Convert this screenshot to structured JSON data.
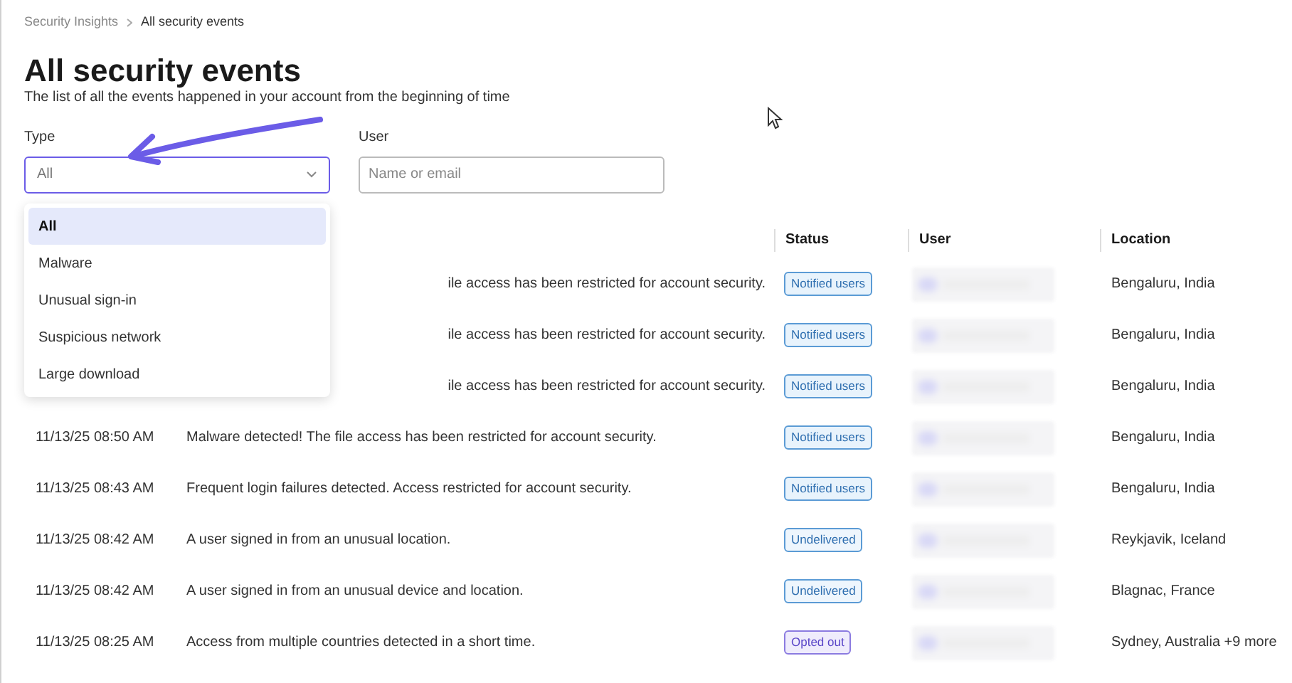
{
  "breadcrumb": [
    "Security Insights",
    "All security events"
  ],
  "title": "All security events",
  "subtitle": "The list of all the events happened in your account from the beginning of time",
  "filters": {
    "type": {
      "label": "Type",
      "value": "All",
      "expanded": true,
      "options": [
        {
          "label": "All",
          "selected": true
        },
        {
          "label": "Malware",
          "selected": false
        },
        {
          "label": "Unusual sign-in",
          "selected": false
        },
        {
          "label": "Suspicious network",
          "selected": false
        },
        {
          "label": "Large download",
          "selected": false
        }
      ]
    },
    "user": {
      "label": "User",
      "placeholder": "Name or email"
    }
  },
  "table": {
    "columns": [
      "Status",
      "User",
      "Location"
    ],
    "rows": [
      {
        "message": "ile access has been restricted for account security.",
        "status": {
          "text": "Notified users",
          "kind": "notified"
        },
        "location": "Bengaluru, India"
      },
      {
        "message": "ile access has been restricted for account security.",
        "status": {
          "text": "Notified users",
          "kind": "notified"
        },
        "location": "Bengaluru, India"
      },
      {
        "message": "ile access has been restricted for account security.",
        "status": {
          "text": "Notified users",
          "kind": "notified"
        },
        "location": "Bengaluru, India"
      },
      {
        "time": "11/13/25 08:50 AM",
        "message": "Malware detected! The file access has been restricted for account security.",
        "status": {
          "text": "Notified users",
          "kind": "notified"
        },
        "location": "Bengaluru, India"
      },
      {
        "time": "11/13/25 08:43 AM",
        "message": "Frequent login failures detected. Access restricted for account security.",
        "status": {
          "text": "Notified users",
          "kind": "notified"
        },
        "location": "Bengaluru, India"
      },
      {
        "time": "11/13/25 08:42 AM",
        "message": "A user signed in from an unusual location.",
        "status": {
          "text": "Undelivered",
          "kind": "undelivered"
        },
        "location": "Reykjavik, Iceland"
      },
      {
        "time": "11/13/25 08:42 AM",
        "message": "A user signed in from an unusual device and location.",
        "status": {
          "text": "Undelivered",
          "kind": "undelivered"
        },
        "location": "Blagnac, France"
      },
      {
        "time": "11/13/25 08:25 AM",
        "message": "Access from multiple countries detected in a short time.",
        "status": {
          "text": "Opted out",
          "kind": "opted_out"
        },
        "location": "Sydney, Australia +9 more"
      }
    ]
  }
}
